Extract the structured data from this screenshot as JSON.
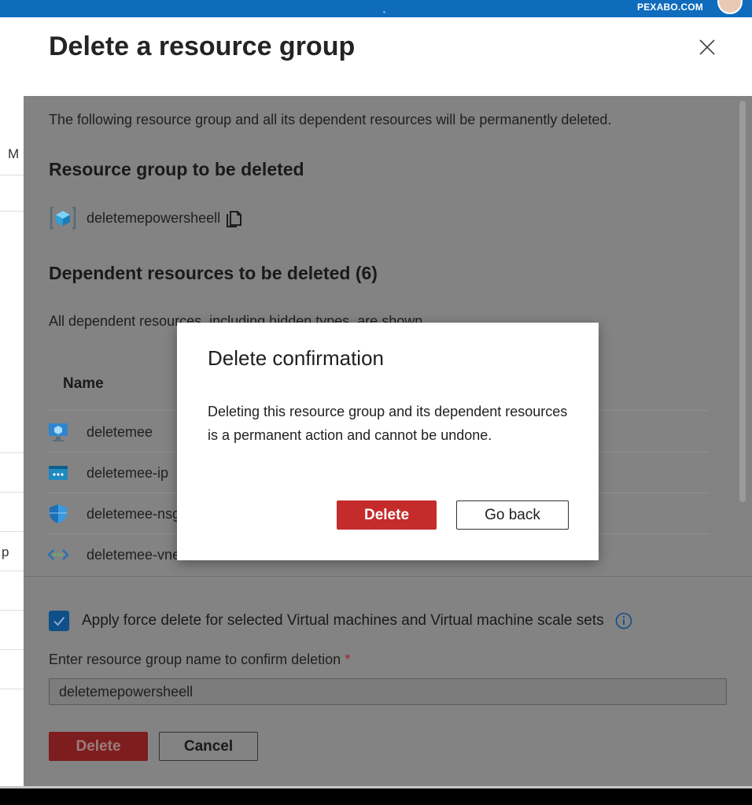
{
  "topbar": {
    "domain": "PEXABO.COM",
    "avatar_icon": "user-avatar"
  },
  "background_page": {
    "header_fragment": "M",
    "row_fragment": "p"
  },
  "panel": {
    "title": "Delete a resource group",
    "close_icon": "close-icon",
    "intro": "The following resource group and all its dependent resources will be permanently deleted.",
    "rg_heading": "Resource group to be deleted",
    "rg_name": "deletemepowersheell",
    "dependent_heading": "Dependent resources to be deleted (6)",
    "dependent_note": "All dependent resources, including hidden types, are shown",
    "column_name": "Name",
    "resources": [
      {
        "name": "deletemee",
        "icon": "virtual-machine-icon"
      },
      {
        "name": "deletemee-ip",
        "icon": "public-ip-icon"
      },
      {
        "name": "deletemee-nsg",
        "icon": "network-security-group-icon"
      },
      {
        "name": "deletemee-vnet",
        "icon": "virtual-network-icon"
      }
    ],
    "force_delete_label": "Apply force delete for selected Virtual machines and Virtual machine scale sets",
    "force_delete_checked": true,
    "confirm_label": "Enter resource group name to confirm deletion",
    "confirm_required_mark": "*",
    "confirm_value": "deletemepowersheell",
    "delete_button": "Delete",
    "cancel_button": "Cancel"
  },
  "modal": {
    "title": "Delete confirmation",
    "message": "Deleting this resource group and its dependent resources is a permanent action and cannot be undone.",
    "delete_button": "Delete",
    "go_back_button": "Go back"
  },
  "colors": {
    "accent": "#0f6cbd",
    "danger": "#c42b2b",
    "overlay": "#838383"
  }
}
